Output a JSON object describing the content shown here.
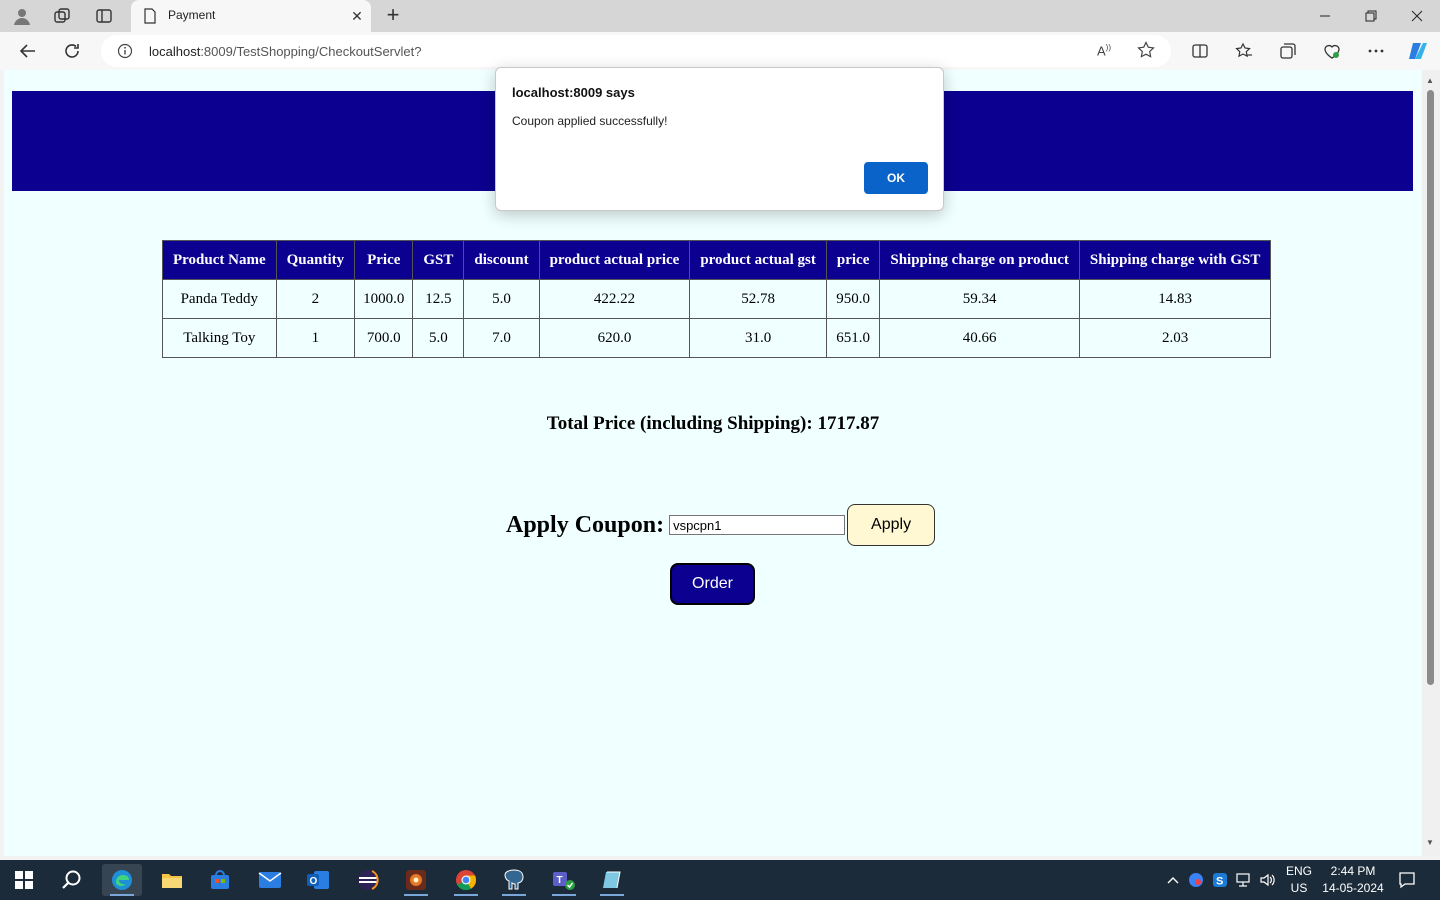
{
  "browser": {
    "tab_title": "Payment",
    "url_host": "localhost",
    "url_rest": ":8009/TestShopping/CheckoutServlet?"
  },
  "table": {
    "headers": [
      "Product Name",
      "Quantity",
      "Price",
      "GST",
      "discount",
      "product actual price",
      "product actual gst",
      "price",
      "Shipping charge on product",
      "Shipping charge with GST"
    ],
    "rows": [
      [
        "Panda Teddy",
        "2",
        "1000.0",
        "12.5",
        "5.0",
        "422.22",
        "52.78",
        "950.0",
        "59.34",
        "14.83"
      ],
      [
        "Talking Toy",
        "1",
        "700.0",
        "5.0",
        "7.0",
        "620.0",
        "31.0",
        "651.0",
        "40.66",
        "2.03"
      ]
    ]
  },
  "total": {
    "label": "Total Price (including Shipping):",
    "value": "1717.87"
  },
  "coupon": {
    "label": "Apply Coupon:",
    "value": "vspcpn1",
    "apply_label": "Apply"
  },
  "order_label": "Order",
  "dialog": {
    "title": "localhost:8009 says",
    "message": "Coupon applied successfully!",
    "ok_label": "OK"
  },
  "taskbar": {
    "lang_top": "ENG",
    "lang_bottom": "US",
    "time": "2:44 PM",
    "date": "14-05-2024"
  },
  "colors": {
    "header_band": "#0b0090",
    "page_bg": "#f0ffff",
    "apply_bg": "#fff8d2",
    "dialog_ok": "#0a63c9"
  }
}
